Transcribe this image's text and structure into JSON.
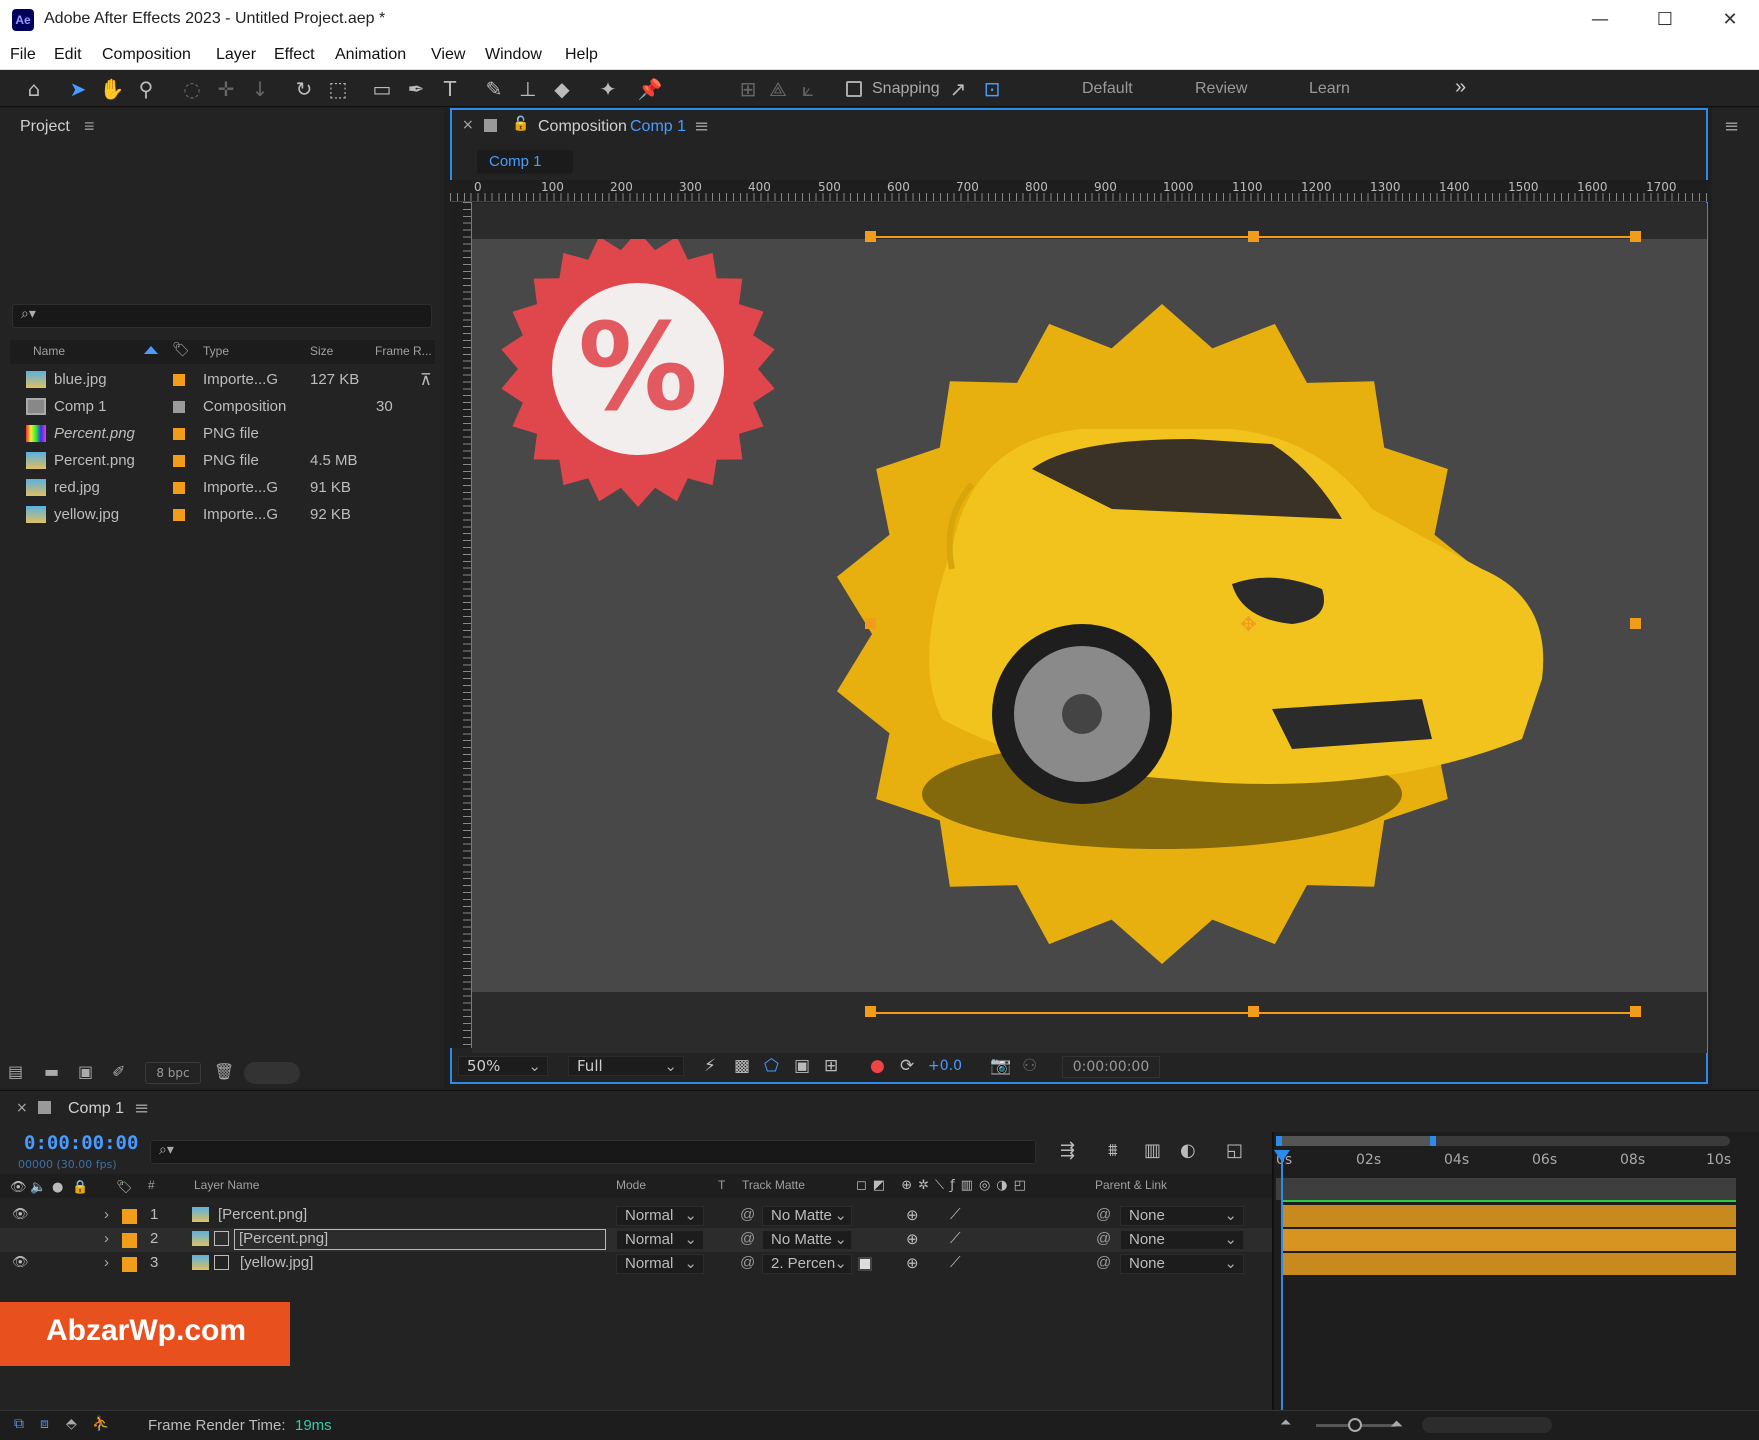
{
  "window": {
    "title": "Adobe After Effects 2023 - Untitled Project.aep *",
    "app_badge": "Ae",
    "minimize": "—",
    "maximize": "☐",
    "close": "✕"
  },
  "menu": [
    "File",
    "Edit",
    "Composition",
    "Layer",
    "Effect",
    "Animation",
    "View",
    "Window",
    "Help"
  ],
  "toolbar": {
    "snapping_label": "Snapping",
    "workspaces": [
      "Default",
      "Review",
      "Learn"
    ],
    "more": "»"
  },
  "project_panel": {
    "tab_label": "Project",
    "menu_icon": "≡",
    "search_icon": "⌕▾",
    "columns": [
      "Name",
      "Type",
      "Size",
      "Frame R..."
    ],
    "items": [
      {
        "name": "blue.jpg",
        "type": "Importe...G",
        "size": "127 KB",
        "frame_rate": "",
        "italic": false
      },
      {
        "name": "Comp 1",
        "type": "Composition",
        "size": "",
        "frame_rate": "30",
        "italic": false
      },
      {
        "name": "Percent.png",
        "type": "PNG file",
        "size": "",
        "frame_rate": "",
        "italic": true
      },
      {
        "name": "Percent.png",
        "type": "PNG file",
        "size": "4.5 MB",
        "frame_rate": "",
        "italic": false
      },
      {
        "name": "red.jpg",
        "type": "Importe...G",
        "size": "91 KB",
        "frame_rate": "",
        "italic": false
      },
      {
        "name": "yellow.jpg",
        "type": "Importe...G",
        "size": "92 KB",
        "frame_rate": "",
        "italic": false
      }
    ],
    "bpc": "8 bpc"
  },
  "composition_panel": {
    "tab_prefix": "Composition",
    "tab_comp": "Comp 1",
    "breadcrumb": "Comp 1",
    "ruler_labels": [
      "0",
      "100",
      "200",
      "300",
      "400",
      "500",
      "600",
      "700",
      "800",
      "900",
      "1000",
      "1100",
      "1200",
      "1300",
      "1400",
      "1500",
      "1600",
      "1700"
    ],
    "zoom": "50%",
    "resolution": "Full",
    "exposure": "+0.0",
    "timecode": "0:00:00:00",
    "badge_text": "%"
  },
  "timeline": {
    "tab_label": "Comp 1",
    "timecode": "0:00:00:00",
    "frame_info": "00000 (30.00 fps)",
    "search_icon": "⌕▾",
    "columns": {
      "hash": "#",
      "layer_name": "Layer Name",
      "mode": "Mode",
      "t": "T",
      "track_matte": "Track Matte",
      "parent": "Parent & Link"
    },
    "ruler": [
      "0s",
      "02s",
      "04s",
      "06s",
      "08s",
      "10s"
    ],
    "layers": [
      {
        "num": "1",
        "name": "[Percent.png]",
        "mode": "Normal",
        "matte": "No Matte",
        "parent": "None",
        "visible": true
      },
      {
        "num": "2",
        "name": "[Percent.png]",
        "mode": "Normal",
        "matte": "No Matte",
        "parent": "None",
        "visible": false
      },
      {
        "num": "3",
        "name": "[yellow.jpg]",
        "mode": "Normal",
        "matte": "2. Percen",
        "parent": "None",
        "visible": true
      }
    ]
  },
  "watermark": "AbzarWp.com",
  "status": {
    "label": "Frame Render Time:",
    "value": "19ms"
  },
  "colors": {
    "accent_blue": "#2d8ceb",
    "label_orange": "#f29d1a",
    "car_yellow": "#e8b00e",
    "badge_red": "#e0474c",
    "watermark_bg": "#e8501e"
  }
}
